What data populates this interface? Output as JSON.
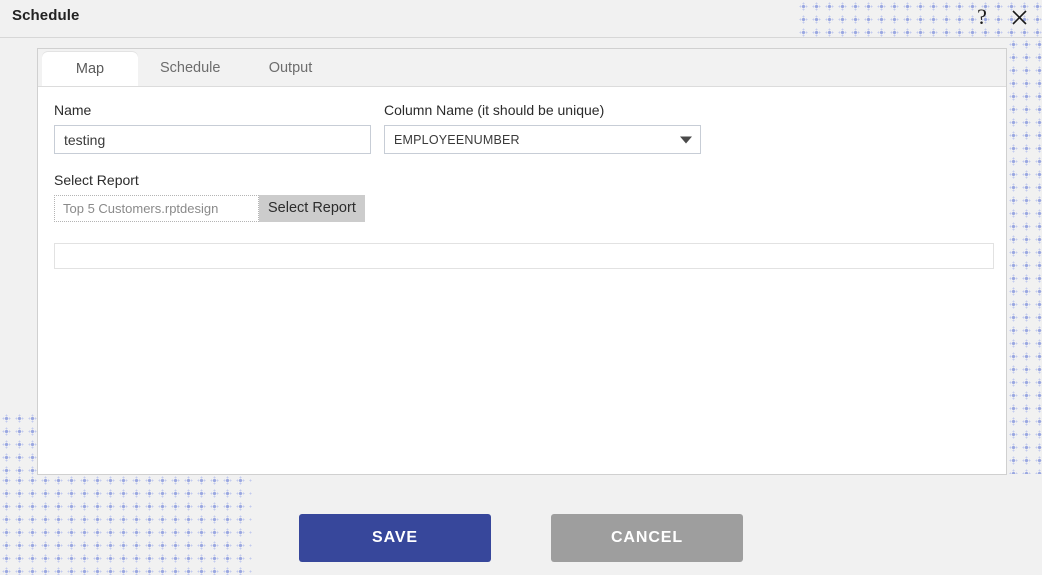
{
  "header": {
    "title": "Schedule",
    "help_icon": "question-mark-icon",
    "help_label": "?",
    "close_icon": "close-icon"
  },
  "tabs": [
    {
      "id": "map",
      "label": "Map",
      "active": true
    },
    {
      "id": "schedule",
      "label": "Schedule",
      "active": false
    },
    {
      "id": "output",
      "label": "Output",
      "active": false
    }
  ],
  "form": {
    "name": {
      "label": "Name",
      "value": "testing",
      "placeholder": ""
    },
    "column_name": {
      "label": "Column Name (it should be unique)",
      "value": "EMPLOYEENUMBER",
      "options": [
        "EMPLOYEENUMBER"
      ],
      "caret_icon": "chevron-down-icon"
    },
    "select_report": {
      "label": "Select Report",
      "value": "",
      "placeholder": "Top 5 Customers.rptdesign",
      "button_label": "Select Report"
    },
    "extra_input": {
      "value": "",
      "placeholder": ""
    }
  },
  "footer": {
    "save_label": "SAVE",
    "cancel_label": "CANCEL"
  },
  "colors": {
    "save_button": "#37479b",
    "cancel_button": "#9e9e9e",
    "panel_background": "#ffffff",
    "page_background": "#f1f1f1",
    "dot_pattern": "#9aa7e0"
  }
}
